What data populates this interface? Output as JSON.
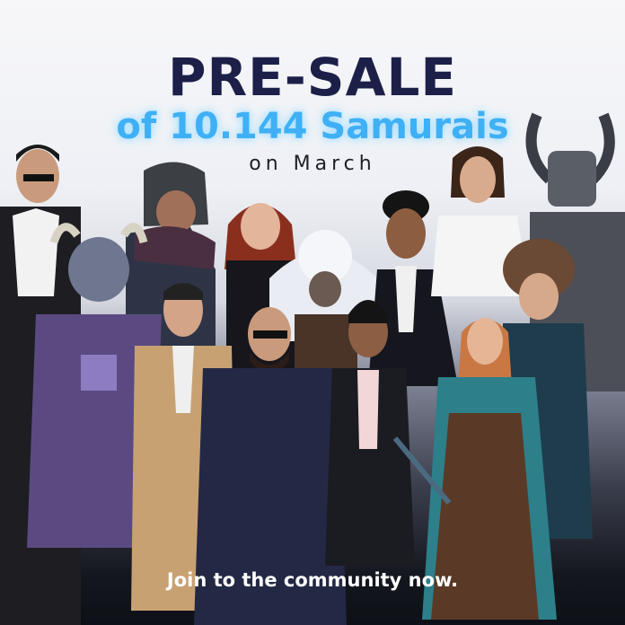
{
  "poster": {
    "headline": "PRE-SALE",
    "subheadline": "of 10.144 Samurais",
    "dateline": "on March",
    "call_to_action": "Join to the community now."
  },
  "colors": {
    "headline": "#1c2048",
    "subheadline": "#3fb0f5",
    "glow": "#9fdcff",
    "dateline": "#1e1e28",
    "call_to_action": "#ffffff"
  },
  "characters": [
    "businessman-sunglasses-icon",
    "bear-helmet-warrior-icon",
    "red-haired-woman-icon",
    "polar-bear-hood-warrior-icon",
    "curly-haired-man-icon",
    "white-coat-woman-icon",
    "horned-helmet-knight-icon",
    "horned-armored-knight-icon",
    "bear-hood-woman-icon",
    "trench-coat-man-icon",
    "bearded-man-peacoat-icon",
    "woman-black-blazer-icon",
    "red-haired-ranger-icon"
  ]
}
